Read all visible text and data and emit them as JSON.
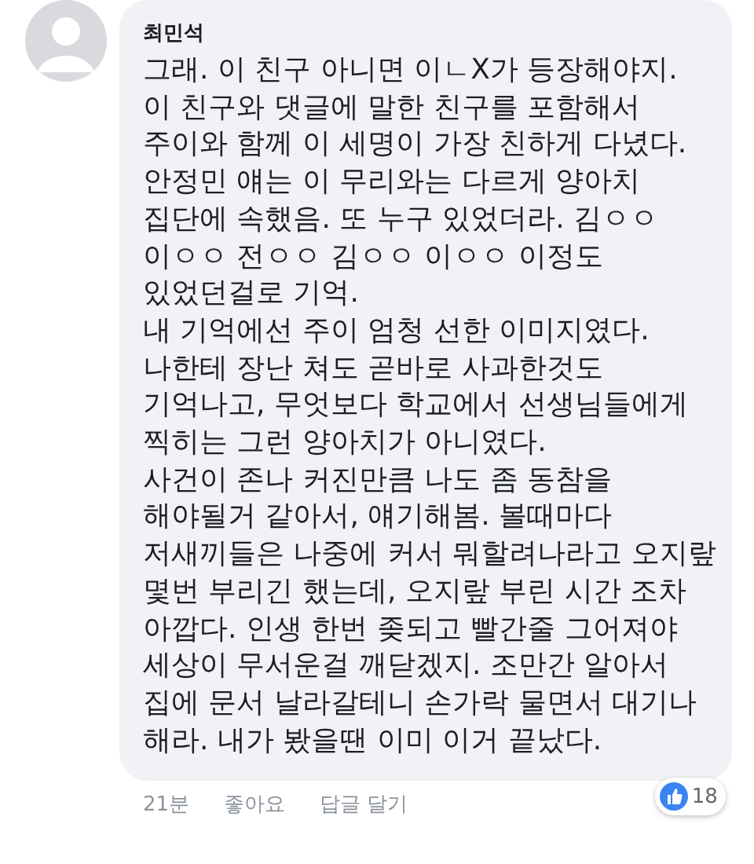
{
  "comment": {
    "author": "최민석",
    "lines": [
      "그래. 이 친구 아니면 이ㄴX가 등장해야지.",
      "이 친구와 댓글에 말한 친구를 포함해서",
      "주이와 함께 이 세명이 가장 친하게 다녔다.",
      "안정민 얘는 이 무리와는 다르게 양아치",
      "집단에 속했음. 또 누구 있었더라. 김ㅇㅇ",
      "이ㅇㅇ 전ㅇㅇ 김ㅇㅇ 이ㅇㅇ 이정도",
      "있었던걸로 기억.",
      "내 기억에선 주이 엄청 선한 이미지였다.",
      "나한테 장난 쳐도 곧바로 사과한것도",
      "기억나고, 무엇보다 학교에서 선생님들에게",
      "찍히는 그런 양아치가 아니였다.",
      "사건이 존나 커진만큼 나도 좀 동참을",
      "해야될거 같아서, 얘기해봄. 볼때마다",
      "저새끼들은 나중에 커서 뭐할려나라고 오지랖",
      "몇번 부리긴 했는데, 오지랖 부린 시간 조차",
      "아깝다. 인생 한번 좆되고 빨간줄 그어져야",
      "세상이 무서운걸 깨닫겠지. 조만간 알아서",
      "집에 문서 날라갈테니 손가락 물면서 대기나",
      "해라. 내가 봤을땐 이미 이거 끝났다."
    ],
    "like_count": "18",
    "actions": [
      "21분",
      "좋아요",
      "답글 달기"
    ]
  }
}
